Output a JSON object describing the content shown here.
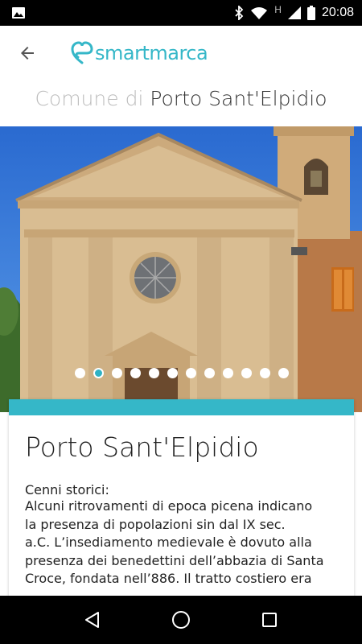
{
  "status_bar": {
    "time": "20:08",
    "icons": [
      "image-icon",
      "bluetooth-icon",
      "wifi-icon",
      "network-h-icon",
      "signal-icon",
      "battery-icon"
    ],
    "network_label": "H"
  },
  "app_bar": {
    "back_icon": "arrow-left-icon",
    "logo_text": "smartmarca",
    "brand_color": "#35b7c8"
  },
  "header": {
    "prefix": "Comune di",
    "name": "Porto Sant'Elpidio"
  },
  "carousel": {
    "slide_count": 12,
    "active_index": 1,
    "dot_color": "#ffffff",
    "active_dot_color": "#2fb2c5"
  },
  "card": {
    "accent_color": "#35b7c8",
    "title": "Porto Sant'Elpidio",
    "subtitle": "Cenni storici:",
    "lines": [
      "Alcuni ritrovamenti di epoca picena indicano",
      "la presenza di popolazioni sin dal IX sec.",
      "a.C. L’insediamento medievale è dovuto alla",
      "presenza dei benedettini dell’abbazia di Santa",
      "Croce, fondata nell’886. Il tratto costiero era"
    ]
  },
  "nav_bar": {
    "icons": [
      "back-triangle-icon",
      "home-circle-icon",
      "recents-square-icon"
    ]
  }
}
